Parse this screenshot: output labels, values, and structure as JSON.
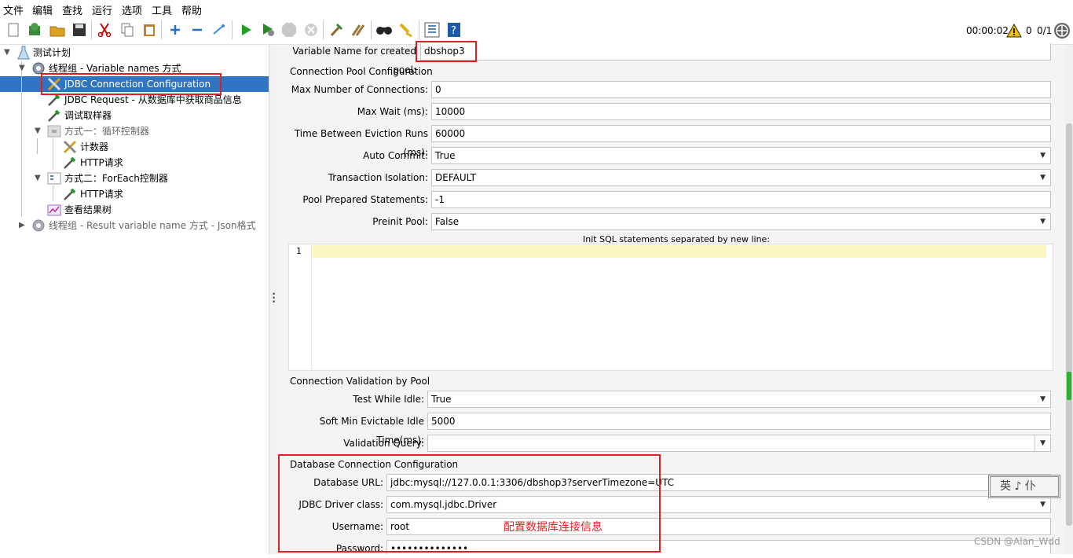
{
  "menu": [
    "文件",
    "编辑",
    "查找",
    "运行",
    "选项",
    "工具",
    "帮助"
  ],
  "toolbar": {
    "icons": [
      "new-icon",
      "templates-icon",
      "open-icon",
      "save-icon",
      "cut-icon",
      "copy-icon",
      "paste-icon",
      "expand-icon",
      "collapse-icon",
      "toggle-icon",
      "start-icon",
      "start-no-pause-icon",
      "stop-icon",
      "shutdown-icon",
      "clear-icon",
      "clear-all-icon",
      "search-icon",
      "reset-search-icon",
      "function-helper-icon",
      "help-icon"
    ],
    "timer": "00:00:02",
    "warnings": "0",
    "threads": "0/1"
  },
  "tree": [
    {
      "label": "测试计划",
      "icon": "test-plan-icon"
    },
    {
      "label": "线程组 - Variable names 方式",
      "icon": "thread-group-icon"
    },
    {
      "label": "JDBC Connection Configuration",
      "icon": "config-tools-icon"
    },
    {
      "label": "JDBC Request - 从数据库中获取商品信息",
      "icon": "sampler-pipette-icon"
    },
    {
      "label": "调试取样器",
      "icon": "sampler-pipette-icon"
    },
    {
      "label": "方式一：循环控制器",
      "icon": "loop-controller-icon"
    },
    {
      "label": "计数器",
      "icon": "config-tools-icon"
    },
    {
      "label": "HTTP请求",
      "icon": "sampler-pipette-icon"
    },
    {
      "label": "方式二：ForEach控制器",
      "icon": "foreach-controller-icon"
    },
    {
      "label": "HTTP请求",
      "icon": "sampler-pipette-icon"
    },
    {
      "label": "查看结果树",
      "icon": "listener-graph-icon"
    },
    {
      "label": "线程组 - Result variable name 方式 - Json格式",
      "icon": "thread-group-icon"
    }
  ],
  "form": {
    "pool_var_label": "Variable Name for created pool:",
    "pool_var_value": "dbshop3",
    "pool_section": "Connection Pool Configuration",
    "max_conn_label": "Max Number of Connections:",
    "max_conn_value": "0",
    "max_wait_label": "Max Wait (ms):",
    "max_wait_value": "10000",
    "eviction_label": "Time Between Eviction Runs (ms):",
    "eviction_value": "60000",
    "auto_commit_label": "Auto Commit:",
    "auto_commit_value": "True",
    "isolation_label": "Transaction Isolation:",
    "isolation_value": "DEFAULT",
    "prepared_label": "Pool Prepared Statements:",
    "prepared_value": "-1",
    "preinit_label": "Preinit Pool:",
    "preinit_value": "False",
    "init_sql_label": "Init SQL statements separated by new line:",
    "editor_line": "1",
    "validation_section": "Connection Validation by Pool",
    "test_idle_label": "Test While Idle:",
    "test_idle_value": "True",
    "soft_min_label": "Soft Min Evictable Idle Time(ms):",
    "soft_min_value": "5000",
    "validation_query_label": "Validation Query:",
    "validation_query_value": "",
    "db_section": "Database Connection Configuration",
    "db_url_label": "Database URL:",
    "db_url_value": "jdbc:mysql://127.0.0.1:3306/dbshop3?serverTimezone=UTC",
    "driver_label": "JDBC Driver class:",
    "driver_value": "com.mysql.jdbc.Driver",
    "username_label": "Username:",
    "username_value": "root",
    "password_label": "Password:",
    "password_value": "••••••••••••••"
  },
  "annotation": "配置数据库连接信息",
  "ime": "英 ♪ 仆",
  "watermark": "CSDN @Alan_Wdd",
  "colors": {
    "selection": "#2f75c2",
    "annotation": "#e02020",
    "editor_highlight": "#fcf7c0"
  }
}
